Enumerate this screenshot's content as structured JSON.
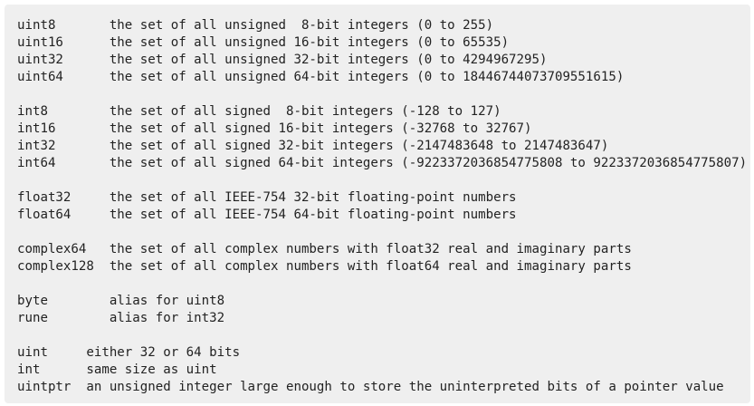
{
  "groups": [
    {
      "lines": [
        "uint8       the set of all unsigned  8-bit integers (0 to 255)",
        "uint16      the set of all unsigned 16-bit integers (0 to 65535)",
        "uint32      the set of all unsigned 32-bit integers (0 to 4294967295)",
        "uint64      the set of all unsigned 64-bit integers (0 to 18446744073709551615)"
      ]
    },
    {
      "lines": [
        "int8        the set of all signed  8-bit integers (-128 to 127)",
        "int16       the set of all signed 16-bit integers (-32768 to 32767)",
        "int32       the set of all signed 32-bit integers (-2147483648 to 2147483647)",
        "int64       the set of all signed 64-bit integers (-9223372036854775808 to 9223372036854775807)"
      ]
    },
    {
      "lines": [
        "float32     the set of all IEEE-754 32-bit floating-point numbers",
        "float64     the set of all IEEE-754 64-bit floating-point numbers"
      ]
    },
    {
      "lines": [
        "complex64   the set of all complex numbers with float32 real and imaginary parts",
        "complex128  the set of all complex numbers with float64 real and imaginary parts"
      ]
    },
    {
      "lines": [
        "byte        alias for uint8",
        "rune        alias for int32"
      ]
    },
    {
      "lines": [
        "uint     either 32 or 64 bits",
        "int      same size as uint",
        "uintptr  an unsigned integer large enough to store the uninterpreted bits of a pointer value"
      ]
    }
  ]
}
